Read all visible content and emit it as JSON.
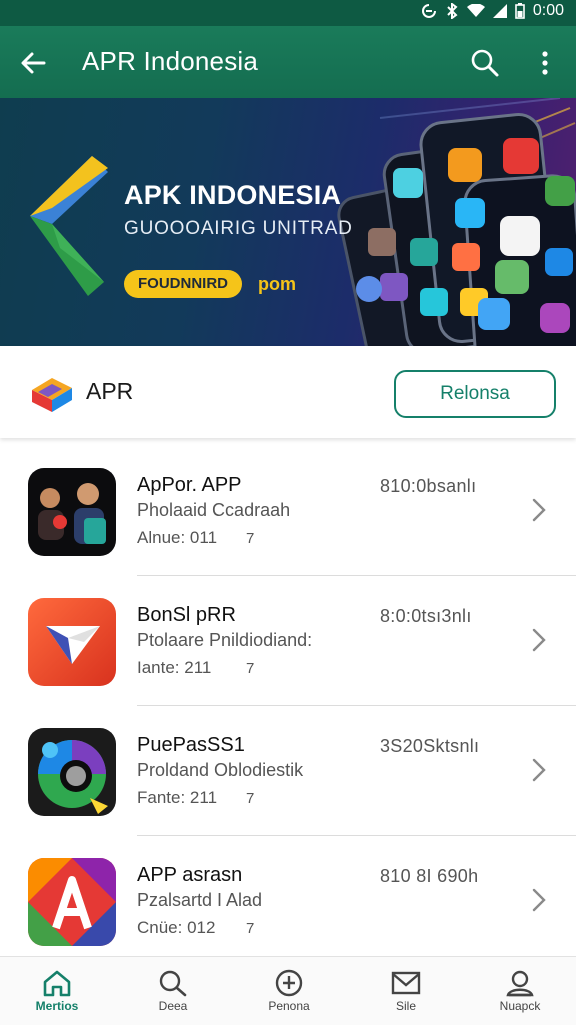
{
  "status": {
    "time": "0:00"
  },
  "appbar": {
    "title": "APR Indonesia"
  },
  "banner": {
    "title": "APK INDONESIA",
    "subtitle": "GUOOOAIRIG UNITRAD",
    "pill": "FOUDNNIRD",
    "pill_after": "pom"
  },
  "filter": {
    "label": "APR",
    "button": "Relonsa"
  },
  "apps": [
    {
      "name": "ApPor. APP",
      "desc": "Pholaaid Ccadraah",
      "meta": "Alnue: 011",
      "meta2": "7",
      "right": "810:0bsanlı"
    },
    {
      "name": "BonSl pRR",
      "desc": "Ptolaare Pnildiodiand:",
      "meta": "Iante: 211",
      "meta2": "7",
      "right": "8:0:0tsı3nlı"
    },
    {
      "name": "PuePasSS1",
      "desc": "Proldand Oblodiestik",
      "meta": "Fante: 211",
      "meta2": "7",
      "right": "3S20Sktsnlı"
    },
    {
      "name": "APP asrasn",
      "desc": "Pzalsartd I Alad",
      "meta": "Cnüe: 012",
      "meta2": "7",
      "right": "810 8I 690h"
    }
  ],
  "nav": [
    {
      "label": "Mertios",
      "icon": "home-icon"
    },
    {
      "label": "Deea",
      "icon": "search-icon"
    },
    {
      "label": "Penona",
      "icon": "download-icon"
    },
    {
      "label": "Sile",
      "icon": "mail-icon"
    },
    {
      "label": "Nuapck",
      "icon": "profile-icon"
    }
  ],
  "colors": {
    "primary": "#15806a",
    "appbar": "#1a7b5a",
    "statusbar": "#0e5a43",
    "pill": "#f5c419"
  }
}
